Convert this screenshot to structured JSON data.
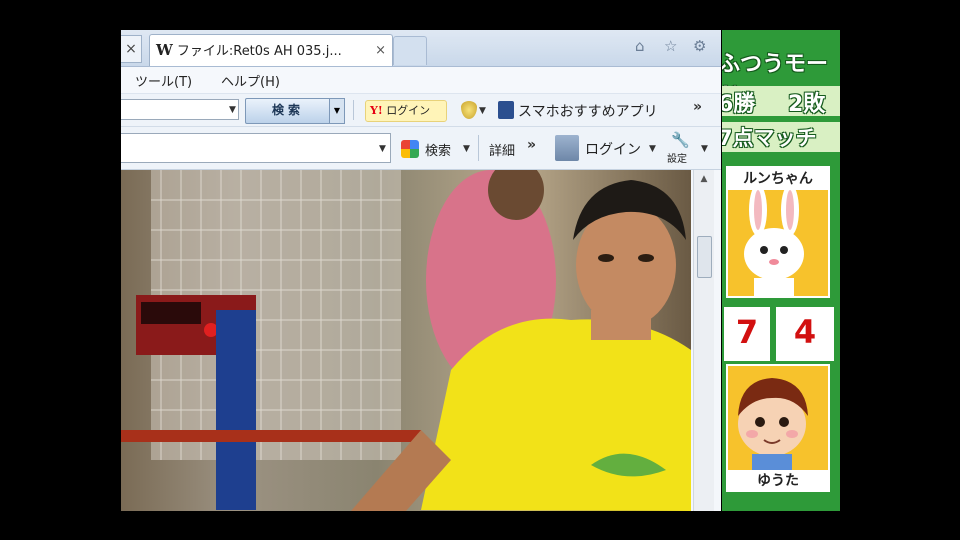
{
  "browser": {
    "tab": {
      "close_glyph": "×",
      "wiki_glyph": "W",
      "title": "ファイル:Ret0s AH 035.j...",
      "close": "×"
    },
    "menu": {
      "tools": "ツール(T)",
      "help": "ヘルプ(H)"
    },
    "toolbar1": {
      "search_label": "検索",
      "yahoo_login_prefix": "Y!",
      "yahoo_login": "ログイン",
      "apps_label": "スマホおすすめアプリ",
      "more": "»"
    },
    "toolbar2": {
      "search_label": "検索",
      "detail_label": "詳細",
      "more": "»",
      "login_label": "ログイン",
      "settings_label": "設定"
    },
    "icons": [
      "home-icon",
      "star-icon",
      "gear-icon",
      "close-icon",
      "shield-icon",
      "apps-icon",
      "google-icon",
      "avatar-icon",
      "wrench-icon"
    ]
  },
  "game": {
    "mode_text": "ふつうモード",
    "record_wins": "6勝",
    "record_losses": "2敗",
    "match_text": "7点マッチ",
    "player1_name": "ルンちゃん",
    "player2_name": "ゆうた",
    "score1": "7",
    "score2": "4"
  },
  "colors": {
    "game_green": "#2e9a39",
    "score_red": "#d21010",
    "card_yellow": "#f7c22c"
  }
}
